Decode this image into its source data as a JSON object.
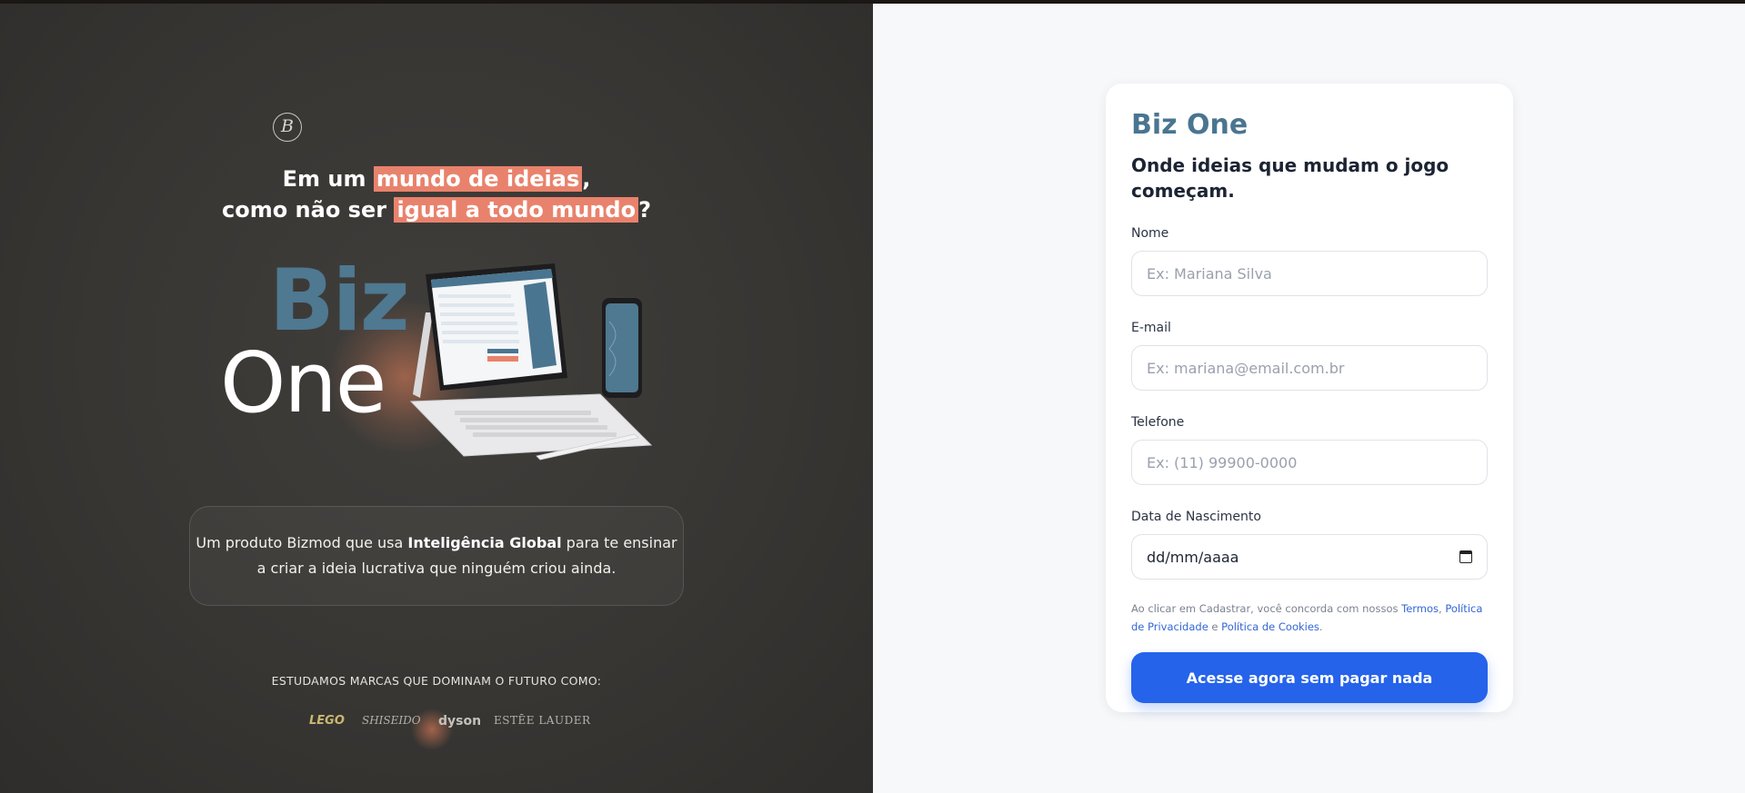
{
  "hero": {
    "logo_letter": "B",
    "headline_line1_pre": "Em um ",
    "headline_line1_hl": "mundo de ideias",
    "headline_line1_post": ",",
    "headline_line2_pre": "como não ser ",
    "headline_line2_hl": "igual a todo mundo",
    "headline_line2_post": "?",
    "brand_top": "Biz",
    "brand_bottom": "One",
    "info_pre": "Um produto Bizmod que usa ",
    "info_bold": "Inteligência Global",
    "info_post": " para te ensinar a criar a ideia lucrativa que ninguém criou ainda.",
    "brands_title": "ESTUDAMOS MARCAS QUE DOMINAM O FUTURO COMO:",
    "brands": [
      "LEGO",
      "SHISEIDO",
      "dyson",
      "ESTĒE LAUDER"
    ]
  },
  "form": {
    "brand": "Biz One",
    "tagline": "Onde ideias que mudam o jogo começam.",
    "name_label": "Nome",
    "name_placeholder": "Ex: Mariana Silva",
    "email_label": "E-mail",
    "email_placeholder": "Ex: mariana@email.com.br",
    "phone_label": "Telefone",
    "phone_placeholder": "Ex: (11) 99900-0000",
    "birth_label": "Data de Nascimento",
    "birth_value": "dd/mm/aaaa",
    "terms_pre": "Ao clicar em Cadastrar, você concorda com nossos ",
    "terms_link1": "Termos",
    "terms_sep1": ", ",
    "terms_link2": "Política de Privacidade",
    "terms_sep2": " e ",
    "terms_link3": "Política de Cookies",
    "terms_post": ".",
    "submit_label": "Acesse agora sem pagar nada"
  },
  "colors": {
    "accent_blue": "#2563eb",
    "brand_teal": "#4a7590",
    "highlight_coral": "#e9826c",
    "left_bg": "#383633"
  }
}
